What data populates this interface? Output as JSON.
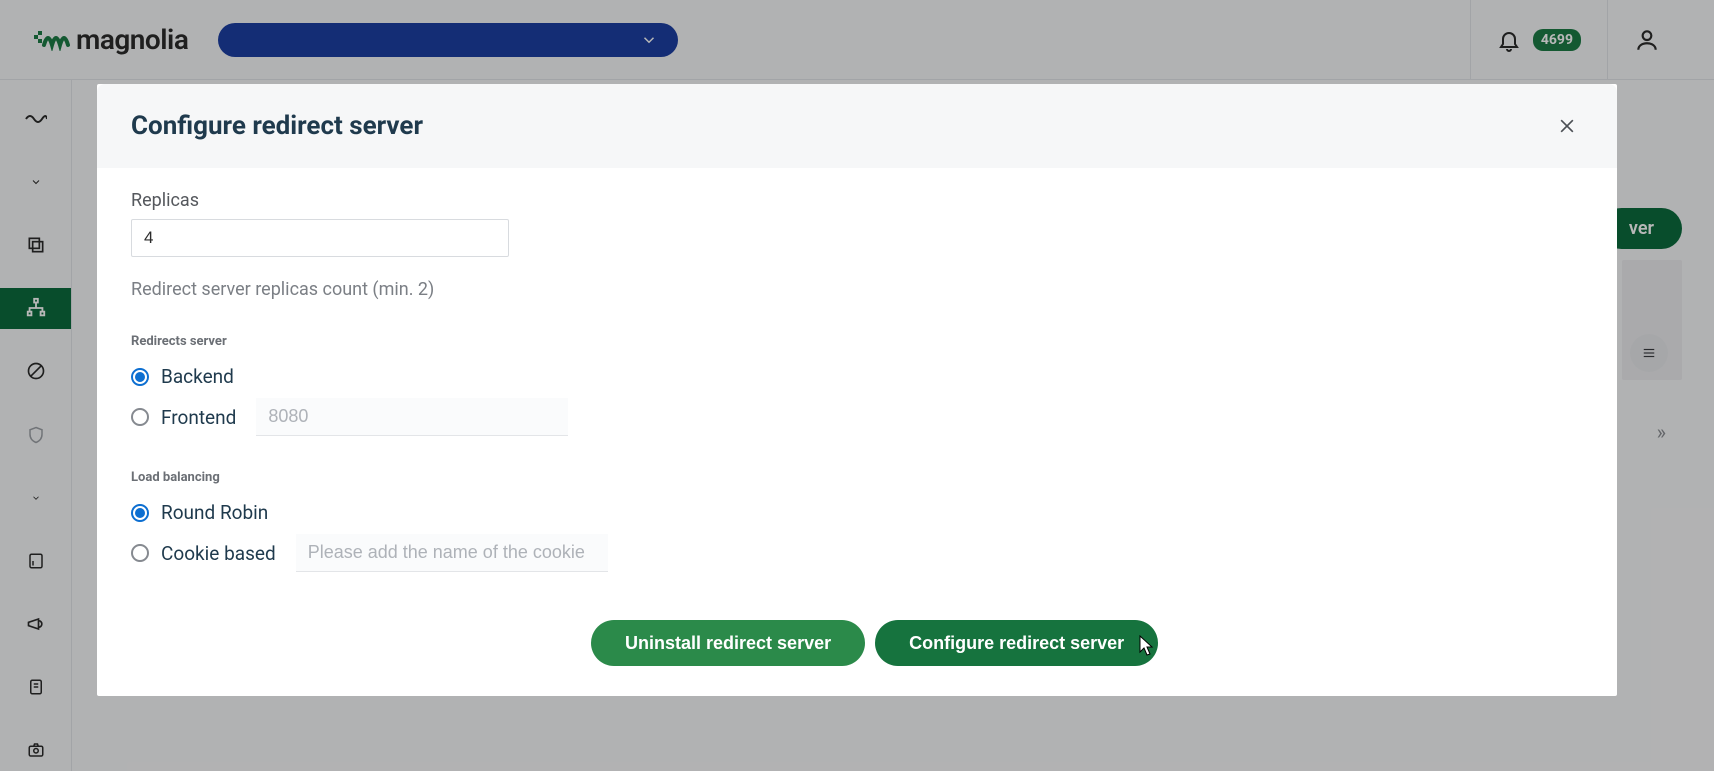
{
  "brand": {
    "name": "magnolia"
  },
  "header": {
    "notifications_count": "4699"
  },
  "modal": {
    "title": "Configure redirect server",
    "replicas_label": "Replicas",
    "replicas_value": "4",
    "replicas_help": "Redirect server replicas count (min. 2)",
    "section_server": "Redirects server",
    "backend_label": "Backend",
    "frontend_label": "Frontend",
    "frontend_port_placeholder": "8080",
    "section_lb": "Load balancing",
    "lb_roundrobin": "Round Robin",
    "lb_cookie": "Cookie based",
    "lb_cookie_placeholder": "Please add the name of the cookie",
    "uninstall_label": "Uninstall redirect server",
    "configure_label": "Configure redirect server"
  },
  "colors": {
    "primary": "#16733e",
    "accent": "#2b8a4a",
    "link": "#0d6fd1"
  }
}
